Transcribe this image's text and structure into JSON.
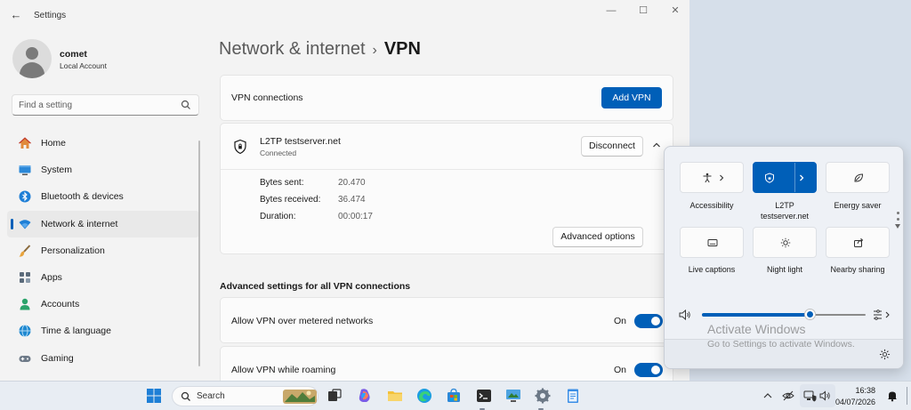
{
  "window": {
    "title": "Settings",
    "back_glyph": "←",
    "minimize_glyph": "—",
    "maximize_glyph": "☐",
    "close_glyph": "✕"
  },
  "user": {
    "name": "comet",
    "account_type": "Local Account"
  },
  "search": {
    "placeholder": "Find a setting"
  },
  "sidebar": {
    "items": [
      {
        "label": "Home",
        "icon": "home-icon"
      },
      {
        "label": "System",
        "icon": "monitor-icon"
      },
      {
        "label": "Bluetooth & devices",
        "icon": "bluetooth-icon"
      },
      {
        "label": "Network & internet",
        "icon": "wifi-icon",
        "active": true
      },
      {
        "label": "Personalization",
        "icon": "brush-icon"
      },
      {
        "label": "Apps",
        "icon": "apps-icon"
      },
      {
        "label": "Accounts",
        "icon": "person-icon"
      },
      {
        "label": "Time & language",
        "icon": "globe-clock-icon"
      },
      {
        "label": "Gaming",
        "icon": "gamepad-icon"
      }
    ]
  },
  "breadcrumb": {
    "parent": "Network & internet",
    "separator": "›",
    "current": "VPN"
  },
  "vpn_connections": {
    "label": "VPN connections",
    "add_button": "Add VPN"
  },
  "vpn_item": {
    "name": "L2TP testserver.net",
    "status": "Connected",
    "disconnect_button": "Disconnect",
    "stats": [
      {
        "label": "Bytes sent:",
        "value": "20.470"
      },
      {
        "label": "Bytes received:",
        "value": "36.474"
      },
      {
        "label": "Duration:",
        "value": "00:00:17"
      }
    ],
    "advanced_button": "Advanced options"
  },
  "advanced_settings": {
    "title": "Advanced settings for all VPN connections",
    "toggles": [
      {
        "label": "Allow VPN over metered networks",
        "state": "On"
      },
      {
        "label": "Allow VPN while roaming",
        "state": "On"
      }
    ]
  },
  "quick_settings": {
    "tiles": [
      {
        "label": "Accessibility",
        "icon": "accessibility-icon",
        "on": false
      },
      {
        "label": "L2TP\ntestserver.net",
        "icon": "vpn-shield-icon",
        "on": true
      },
      {
        "label": "Energy saver",
        "icon": "leaf-icon",
        "on": false
      },
      {
        "label": "Live captions",
        "icon": "captions-icon",
        "on": false
      },
      {
        "label": "Night light",
        "icon": "sun-icon",
        "on": false
      },
      {
        "label": "Nearby sharing",
        "icon": "share-icon",
        "on": false
      }
    ],
    "volume_level": 0.66,
    "watermark_title": "Activate Windows",
    "watermark_subtitle": "Go to Settings to activate Windows."
  },
  "taskbar": {
    "search_label": "Search",
    "time": "16:38",
    "date": "04/07/2026"
  },
  "colors": {
    "accent": "#005fb8",
    "window_bg": "#f3f3f3",
    "card_bg": "#fbfbfb"
  }
}
